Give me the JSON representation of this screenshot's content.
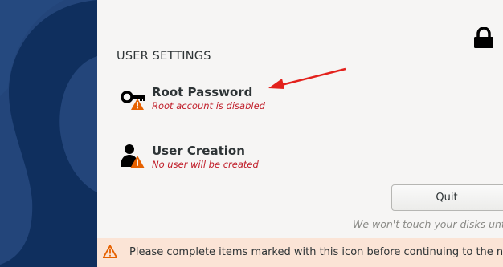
{
  "sidebar": {
    "background": "#23457a"
  },
  "header": {
    "lock_icon": "lock-icon"
  },
  "section": {
    "title": "USER SETTINGS"
  },
  "spokes": [
    {
      "icon": "key-icon",
      "title": "Root Password",
      "status": "Root account is disabled"
    },
    {
      "icon": "user-icon",
      "title": "User Creation",
      "status": "No user will be created"
    }
  ],
  "actions": {
    "quit_label": "Quit",
    "disk_note": "We won't touch your disks until"
  },
  "warning_bar": {
    "text": "Please complete items marked with this icon before continuing to the next ste",
    "background": "#fbe4d6"
  },
  "colors": {
    "error": "#c01c28",
    "warning": "#e66100",
    "annotation_arrow": "#e3211c"
  }
}
